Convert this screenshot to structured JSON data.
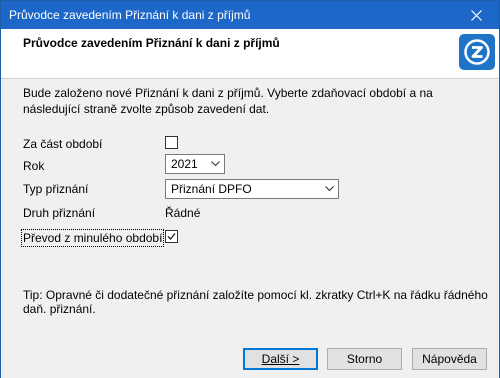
{
  "window": {
    "title": "Průvodce zavedením Přiznání k dani z příjmů"
  },
  "header": {
    "title": "Průvodce zavedením Přiznání k dani z příjmů"
  },
  "description": "Bude založeno nové Přiznání k dani z příjmů. Vyberte zdaňovací období a na následující straně zvolte způsob zavedení dat.",
  "form": {
    "za_cast_obdobi": {
      "label": "Za část období",
      "checked": false
    },
    "rok": {
      "label": "Rok",
      "value": "2021"
    },
    "typ_priznani": {
      "label": "Typ přiznání",
      "value": "Přiznání DPFO"
    },
    "druh_priznani": {
      "label": "Druh přiznání",
      "value": "Řádné"
    },
    "prevod": {
      "label": "Převod z minulého období",
      "checked": true
    }
  },
  "tip": "Tip:  Opravné či dodatečné přiznání založíte pomocí kl. zkratky Ctrl+K na řádku řádného daň. přiznání.",
  "buttons": {
    "next": "Další >",
    "cancel": "Storno",
    "help": "Nápověda"
  },
  "colors": {
    "titlebar": "#1d67c9",
    "logo": "#1f74c9",
    "panel": "#f0f0f0"
  },
  "icons": {
    "close": "close-icon",
    "logo": "app-logo-icon",
    "dropdown": "chevron-down-icon",
    "check": "checkmark-icon"
  }
}
